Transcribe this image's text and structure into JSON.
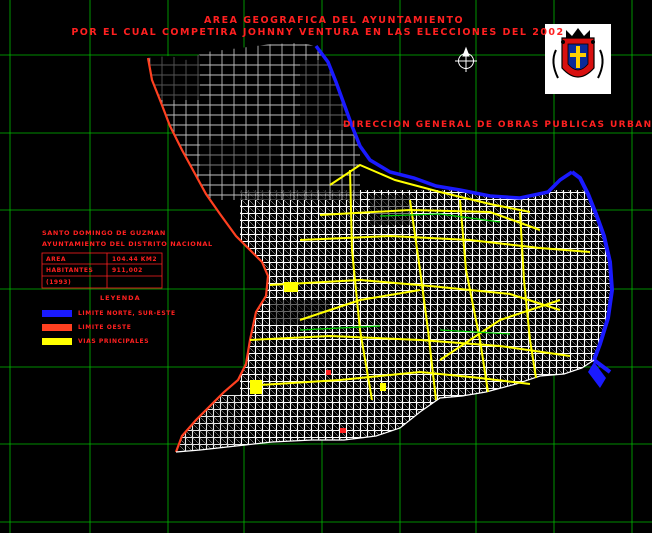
{
  "header": {
    "title_line1": "AREA GEOGRAFICA DEL AYUNTAMIENTO",
    "title_line2": "POR EL CUAL COMPETIRA JOHNNY VENTURA EN LAS ELECCIONES DEL 2002"
  },
  "department": "DIRECCION GENERAL DE OBRAS PUBLICAS URBANAS",
  "info_box": {
    "title_line1": "SANTO DOMINGO DE GUZMAN",
    "title_line2": "AYUNTAMIENTO DEL DISTRITO NACIONAL",
    "rows": [
      {
        "label": "AREA",
        "value": "104.44 KM2"
      },
      {
        "label": "HABITANTES",
        "value": "911,002"
      },
      {
        "label": "(1993)",
        "value": ""
      }
    ]
  },
  "legend": {
    "title": "LEYENDA",
    "items": [
      {
        "label": "LIMITE NORTE, SUR-ESTE",
        "color": "#1a1aff"
      },
      {
        "label": "LIMITE OESTE",
        "color": "#ff4020"
      },
      {
        "label": "VIAS PRINCIPALES",
        "color": "#ffff00"
      }
    ]
  },
  "colors": {
    "background": "#000000",
    "grid": "#00e000",
    "streets": "#ffffff",
    "text": "#ff2020"
  },
  "icons": {
    "north_arrow": "north-arrow-icon",
    "coat_of_arms": "coat-of-arms-icon"
  }
}
